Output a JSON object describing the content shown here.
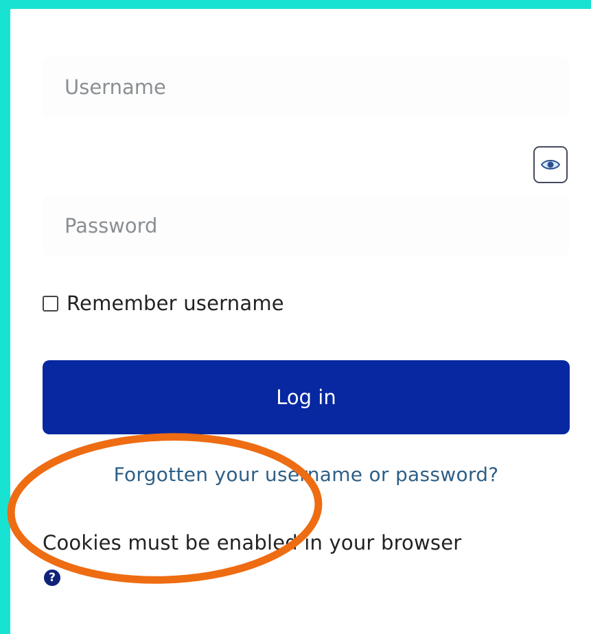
{
  "login_form": {
    "username_placeholder": "Username",
    "username_value": "",
    "password_placeholder": "Password",
    "password_value": "",
    "reveal_password_icon": "eye-icon",
    "remember_label": "Remember username",
    "remember_checked": false,
    "login_button_label": "Log in",
    "forgot_link_label": "Forgotten your username or password?",
    "cookies_notice": "Cookies must be enabled in your browser",
    "help_icon_glyph": "?"
  },
  "colors": {
    "page_background": "#18e3d3",
    "card_background": "#ffffff",
    "primary_button": "#0728a1",
    "link": "#2e5f86",
    "help_icon": "#10237a",
    "annotation_ellipse": "#ee6c12"
  }
}
